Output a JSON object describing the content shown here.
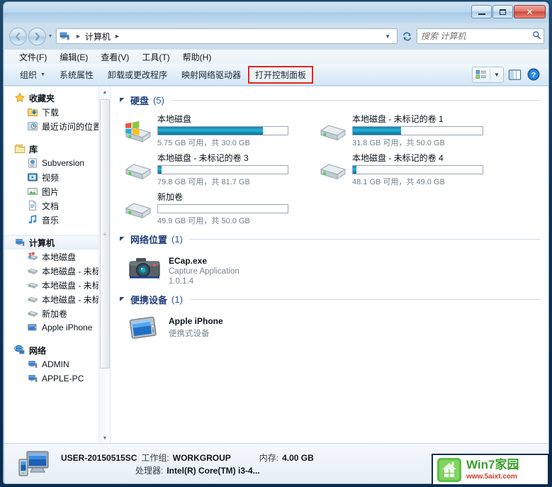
{
  "window": {
    "title": "",
    "buttons": {
      "minimize": "minimize-button",
      "maximize": "maximize-button",
      "close": "✕"
    }
  },
  "nav": {
    "back_label": "◄",
    "forward_label": "►",
    "history_caret": "▼",
    "breadcrumb": {
      "icon": "computer-icon",
      "sep1": "►",
      "text": "计算机",
      "sep2": "►"
    },
    "address_dropdown": "▼",
    "refresh_label": "↻",
    "search_placeholder": "搜索 计算机",
    "search_value": "",
    "search_icon": "🔍"
  },
  "menubar": {
    "items": [
      {
        "label": "文件(F)"
      },
      {
        "label": "编辑(E)"
      },
      {
        "label": "查看(V)"
      },
      {
        "label": "工具(T)"
      },
      {
        "label": "帮助(H)"
      }
    ]
  },
  "toolbar": {
    "items": [
      {
        "label": "组织",
        "caret": "▼",
        "highlighted": false
      },
      {
        "label": "系统属性",
        "caret": "",
        "highlighted": false
      },
      {
        "label": "卸载或更改程序",
        "caret": "",
        "highlighted": false
      },
      {
        "label": "映射网络驱动器",
        "caret": "",
        "highlighted": false
      },
      {
        "label": "打开控制面板",
        "caret": "",
        "highlighted": true
      }
    ],
    "highlight_color": "#e8231d",
    "view_caret": "▼"
  },
  "navpane": {
    "scroll_up": "▲",
    "scroll_down": "▼",
    "grip": "≡",
    "groups": [
      {
        "root": {
          "label": "收藏夹",
          "icon": "star-icon"
        },
        "children": [
          {
            "label": "下载",
            "icon": "downloads-icon"
          },
          {
            "label": "最近访问的位置",
            "icon": "recent-places-icon"
          }
        ]
      },
      {
        "root": {
          "label": "库",
          "icon": "library-icon"
        },
        "children": [
          {
            "label": "Subversion",
            "icon": "subversion-icon"
          },
          {
            "label": "视频",
            "icon": "videos-icon"
          },
          {
            "label": "图片",
            "icon": "pictures-icon"
          },
          {
            "label": "文档",
            "icon": "documents-icon"
          },
          {
            "label": "音乐",
            "icon": "music-icon"
          }
        ]
      },
      {
        "root": {
          "label": "计算机",
          "icon": "computer-icon",
          "selected": true
        },
        "children": [
          {
            "label": "本地磁盘",
            "icon": "system-drive-icon"
          },
          {
            "label": "本地磁盘 - 未标i",
            "icon": "drive-icon"
          },
          {
            "label": "本地磁盘 - 未标i",
            "icon": "drive-icon"
          },
          {
            "label": "本地磁盘 - 未标i",
            "icon": "drive-icon"
          },
          {
            "label": "新加卷",
            "icon": "drive-icon"
          },
          {
            "label": "Apple iPhone",
            "icon": "iphone-icon"
          }
        ]
      },
      {
        "root": {
          "label": "网络",
          "icon": "network-icon"
        },
        "children": [
          {
            "label": "ADMIN",
            "icon": "computer-icon"
          },
          {
            "label": "APPLE-PC",
            "icon": "computer-icon"
          }
        ]
      }
    ]
  },
  "itemview": {
    "groups": [
      {
        "id": "hard-disks",
        "triangle": "◢",
        "title": "硬盘",
        "count": "(5)",
        "items": [
          {
            "name": "本地磁盘",
            "free_total": "5.75 GB 可用，共 30.0 GB",
            "used_pct": 81,
            "icon": "system-drive-icon"
          },
          {
            "name": "本地磁盘 - 未标记的卷 1",
            "free_total": "31.8 GB 可用，共 50.0 GB",
            "used_pct": 37,
            "icon": "drive-icon"
          },
          {
            "name": "本地磁盘 - 未标记的卷 3",
            "free_total": "79.8 GB 可用，共 81.7 GB",
            "used_pct": 3,
            "icon": "drive-icon"
          },
          {
            "name": "本地磁盘 - 未标记的卷 4",
            "free_total": "48.1 GB 可用，共 49.0 GB",
            "used_pct": 3,
            "icon": "drive-icon"
          },
          {
            "name": "新加卷",
            "free_total": "49.9 GB 可用，共 50.0 GB",
            "used_pct": 0,
            "icon": "drive-icon"
          }
        ]
      },
      {
        "id": "network-locations",
        "triangle": "◢",
        "title": "网络位置",
        "count": "(1)",
        "items": [
          {
            "name": "ECap.exe",
            "line2": "Capture Application",
            "line3": "1.0.1.4",
            "icon": "camera-icon"
          }
        ]
      },
      {
        "id": "portable-devices",
        "triangle": "◢",
        "title": "便携设备",
        "count": "(1)",
        "items": [
          {
            "name": "Apple iPhone",
            "line2": "便携式设备",
            "line3": "",
            "icon": "iphone-icon"
          }
        ]
      }
    ]
  },
  "details": {
    "computer_name": "USER-20150515SC",
    "workgroup_label": "工作组:",
    "workgroup_value": "WORKGROUP",
    "memory_label": "内存:",
    "memory_value": "4.00 GB",
    "processor_label": "处理器:",
    "processor_value": "Intel(R) Core(TM) i3-4..."
  },
  "watermark": {
    "title": "Win7家园",
    "url": "www.5aixt.com"
  }
}
